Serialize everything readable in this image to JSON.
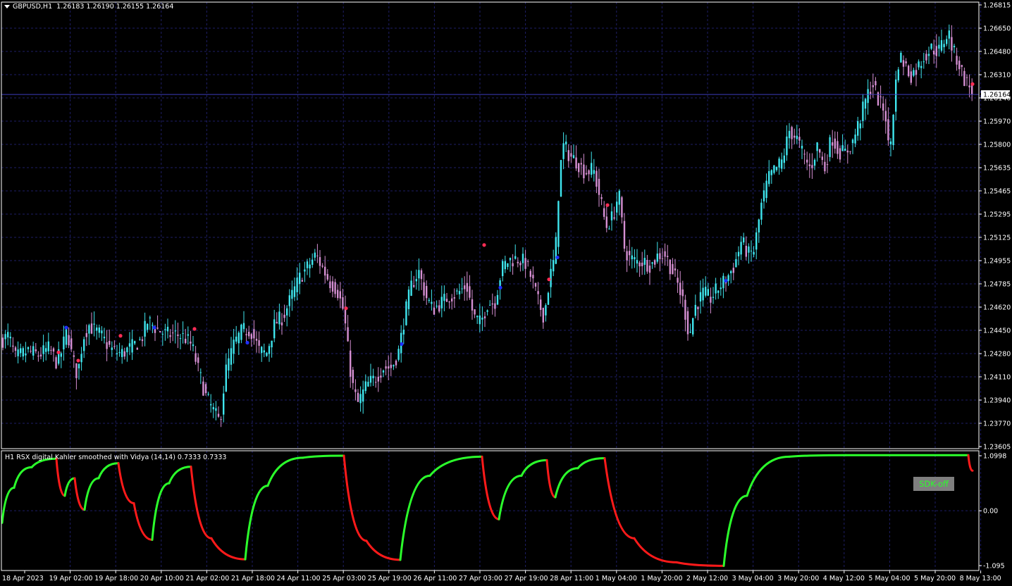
{
  "header": {
    "symbol": "GBPUSD,H1",
    "ohlc": "1.26183 1.26190 1.26155 1.26164"
  },
  "indicator": {
    "title": "H1 RSX digital Kahler smoothed with Vidya (14,14) 0.7333 0.7333",
    "button_label": "SDK-off",
    "yticks": [
      "1.0998",
      "0.00",
      "-1.095"
    ]
  },
  "colors": {
    "background": "#000000",
    "grid": "#1e1e66",
    "frame": "#ffffff",
    "candle_up": "#3fe6ee",
    "candle_down": "#d58fd2",
    "dot_up": "#1e2fff",
    "dot_down": "#ff2d55",
    "rsx_up": "#2bff2b",
    "rsx_down": "#ff1a1a",
    "button_bg": "#7f7f7f",
    "button_text": "#2bff2b"
  },
  "chart_data": {
    "type": "candlestick",
    "price_axis": {
      "ylim": [
        1.23605,
        1.26815
      ],
      "ticks": [
        "1.26815",
        "1.26650",
        "1.26480",
        "1.26310",
        "1.26140",
        "1.25970",
        "1.25800",
        "1.25635",
        "1.25465",
        "1.25295",
        "1.25125",
        "1.24955",
        "1.24785",
        "1.24620",
        "1.24450",
        "1.24280",
        "1.24110",
        "1.23940",
        "1.23770",
        "1.23605"
      ],
      "current_price": "1.26164"
    },
    "time_axis": {
      "labels": [
        "18 Apr 2023",
        "19 Apr 02:00",
        "19 Apr 18:00",
        "20 Apr 10:00",
        "21 Apr 02:00",
        "21 Apr 18:00",
        "24 Apr 11:00",
        "25 Apr 03:00",
        "25 Apr 19:00",
        "26 Apr 11:00",
        "27 Apr 03:00",
        "27 Apr 19:00",
        "28 Apr 11:00",
        "1 May 04:00",
        "1 May 20:00",
        "2 May 12:00",
        "3 May 04:00",
        "3 May 20:00",
        "4 May 12:00",
        "5 May 04:00",
        "5 May 20:00",
        "8 May 13:00"
      ]
    },
    "price_path": [
      [
        0,
        1.2437
      ],
      [
        12,
        1.2441
      ],
      [
        22,
        1.2425
      ],
      [
        40,
        1.243
      ],
      [
        55,
        1.2427
      ],
      [
        70,
        1.2432
      ],
      [
        80,
        1.2422
      ],
      [
        88,
        1.243
      ],
      [
        95,
        1.2447
      ],
      [
        102,
        1.2426
      ],
      [
        110,
        1.2412
      ],
      [
        118,
        1.244
      ],
      [
        126,
        1.2449
      ],
      [
        134,
        1.2445
      ],
      [
        142,
        1.2442
      ],
      [
        150,
        1.2436
      ],
      [
        160,
        1.243
      ],
      [
        172,
        1.2428
      ],
      [
        185,
        1.2432
      ],
      [
        200,
        1.2438
      ],
      [
        210,
        1.2452
      ],
      [
        222,
        1.2446
      ],
      [
        236,
        1.2442
      ],
      [
        250,
        1.2442
      ],
      [
        262,
        1.244
      ],
      [
        272,
        1.2434
      ],
      [
        282,
        1.2415
      ],
      [
        292,
        1.2397
      ],
      [
        304,
        1.2385
      ],
      [
        312,
        1.2378
      ],
      [
        320,
        1.2415
      ],
      [
        332,
        1.2435
      ],
      [
        344,
        1.2445
      ],
      [
        356,
        1.2445
      ],
      [
        368,
        1.243
      ],
      [
        378,
        1.2428
      ],
      [
        390,
        1.245
      ],
      [
        402,
        1.2455
      ],
      [
        414,
        1.247
      ],
      [
        426,
        1.2484
      ],
      [
        438,
        1.2492
      ],
      [
        448,
        1.25
      ],
      [
        458,
        1.249
      ],
      [
        468,
        1.248
      ],
      [
        478,
        1.2475
      ],
      [
        488,
        1.2458
      ],
      [
        496,
        1.242
      ],
      [
        502,
        1.24
      ],
      [
        508,
        1.2392
      ],
      [
        520,
        1.2405
      ],
      [
        532,
        1.241
      ],
      [
        544,
        1.2418
      ],
      [
        556,
        1.2418
      ],
      [
        566,
        1.243
      ],
      [
        574,
        1.2455
      ],
      [
        584,
        1.2478
      ],
      [
        594,
        1.2488
      ],
      [
        604,
        1.247
      ],
      [
        614,
        1.246
      ],
      [
        626,
        1.2465
      ],
      [
        638,
        1.247
      ],
      [
        650,
        1.2472
      ],
      [
        662,
        1.2478
      ],
      [
        672,
        1.2455
      ],
      [
        682,
        1.245
      ],
      [
        692,
        1.2465
      ],
      [
        702,
        1.2465
      ],
      [
        712,
        1.249
      ],
      [
        722,
        1.2496
      ],
      [
        734,
        1.2497
      ],
      [
        746,
        1.2494
      ],
      [
        756,
        1.248
      ],
      [
        764,
        1.2465
      ],
      [
        772,
        1.2455
      ],
      [
        780,
        1.2483
      ],
      [
        788,
        1.25
      ],
      [
        794,
        1.256
      ],
      [
        800,
        1.258
      ],
      [
        808,
        1.2572
      ],
      [
        818,
        1.2568
      ],
      [
        830,
        1.256
      ],
      [
        842,
        1.2562
      ],
      [
        852,
        1.254
      ],
      [
        860,
        1.252
      ],
      [
        870,
        1.2528
      ],
      [
        878,
        1.2545
      ],
      [
        886,
        1.2505
      ],
      [
        892,
        1.2498
      ],
      [
        902,
        1.2495
      ],
      [
        914,
        1.2495
      ],
      [
        924,
        1.2492
      ],
      [
        934,
        1.25
      ],
      [
        944,
        1.25
      ],
      [
        954,
        1.2488
      ],
      [
        962,
        1.2478
      ],
      [
        970,
        1.2465
      ],
      [
        978,
        1.244
      ],
      [
        986,
        1.2462
      ],
      [
        998,
        1.2472
      ],
      [
        1008,
        1.2468
      ],
      [
        1018,
        1.2475
      ],
      [
        1030,
        1.2482
      ],
      [
        1042,
        1.2492
      ],
      [
        1052,
        1.251
      ],
      [
        1062,
        1.25
      ],
      [
        1070,
        1.2503
      ],
      [
        1080,
        1.2535
      ],
      [
        1090,
        1.2555
      ],
      [
        1100,
        1.2562
      ],
      [
        1110,
        1.2568
      ],
      [
        1120,
        1.259
      ],
      [
        1130,
        1.2585
      ],
      [
        1140,
        1.2572
      ],
      [
        1150,
        1.2562
      ],
      [
        1160,
        1.258
      ],
      [
        1170,
        1.2562
      ],
      [
        1180,
        1.2586
      ],
      [
        1190,
        1.2575
      ],
      [
        1200,
        1.2574
      ],
      [
        1210,
        1.2582
      ],
      [
        1220,
        1.2598
      ],
      [
        1230,
        1.2615
      ],
      [
        1238,
        1.2625
      ],
      [
        1248,
        1.261
      ],
      [
        1256,
        1.2605
      ],
      [
        1262,
        1.257
      ],
      [
        1270,
        1.262
      ],
      [
        1276,
        1.2645
      ],
      [
        1284,
        1.2638
      ],
      [
        1292,
        1.263
      ],
      [
        1302,
        1.2636
      ],
      [
        1312,
        1.2645
      ],
      [
        1322,
        1.265
      ],
      [
        1332,
        1.2648
      ],
      [
        1340,
        1.2656
      ],
      [
        1346,
        1.2662
      ],
      [
        1352,
        1.2648
      ],
      [
        1360,
        1.264
      ],
      [
        1368,
        1.2628
      ],
      [
        1376,
        1.2622
      ],
      [
        1382,
        1.26164
      ]
    ],
    "signal_dots": [
      {
        "x": 83,
        "price": 1.2429,
        "kind": "down"
      },
      {
        "x": 94,
        "price": 1.2447,
        "kind": "up"
      },
      {
        "x": 111,
        "price": 1.2423,
        "kind": "down"
      },
      {
        "x": 171,
        "price": 1.2441,
        "kind": "down"
      },
      {
        "x": 219,
        "price": 1.2447,
        "kind": "up"
      },
      {
        "x": 276,
        "price": 1.2446,
        "kind": "down"
      },
      {
        "x": 351,
        "price": 1.2436,
        "kind": "up"
      },
      {
        "x": 491,
        "price": 1.2461,
        "kind": "down"
      },
      {
        "x": 570,
        "price": 1.2435,
        "kind": "up"
      },
      {
        "x": 687,
        "price": 1.2507,
        "kind": "down"
      },
      {
        "x": 710,
        "price": 1.2476,
        "kind": "up"
      },
      {
        "x": 779,
        "price": 1.2482,
        "kind": "down"
      },
      {
        "x": 791,
        "price": 1.2498,
        "kind": "up"
      },
      {
        "x": 862,
        "price": 1.2536,
        "kind": "down"
      },
      {
        "x": 1030,
        "price": 1.2481,
        "kind": "up"
      },
      {
        "x": 1380,
        "price": 1.2624,
        "kind": "down"
      }
    ],
    "rsx_series": [
      {
        "x": 3,
        "y": -0.24,
        "dir": "up"
      },
      {
        "x": 20,
        "y": 0.46,
        "dir": "up"
      },
      {
        "x": 45,
        "y": 0.87,
        "dir": "up"
      },
      {
        "x": 80,
        "y": 1.04,
        "dir": "up"
      },
      {
        "x": 92,
        "y": 0.3,
        "dir": "down"
      },
      {
        "x": 106,
        "y": 0.65,
        "dir": "up"
      },
      {
        "x": 120,
        "y": 0.02,
        "dir": "down"
      },
      {
        "x": 140,
        "y": 0.65,
        "dir": "up"
      },
      {
        "x": 168,
        "y": 0.95,
        "dir": "up"
      },
      {
        "x": 190,
        "y": 0.15,
        "dir": "down"
      },
      {
        "x": 216,
        "y": -0.58,
        "dir": "down"
      },
      {
        "x": 240,
        "y": 0.55,
        "dir": "up"
      },
      {
        "x": 271,
        "y": 0.88,
        "dir": "up"
      },
      {
        "x": 300,
        "y": -0.55,
        "dir": "down"
      },
      {
        "x": 348,
        "y": -0.97,
        "dir": "down"
      },
      {
        "x": 380,
        "y": 0.5,
        "dir": "up"
      },
      {
        "x": 430,
        "y": 1.06,
        "dir": "up"
      },
      {
        "x": 488,
        "y": 1.1,
        "dir": "up"
      },
      {
        "x": 520,
        "y": -0.6,
        "dir": "down"
      },
      {
        "x": 568,
        "y": -0.98,
        "dir": "down"
      },
      {
        "x": 610,
        "y": 0.7,
        "dir": "up"
      },
      {
        "x": 684,
        "y": 1.08,
        "dir": "up"
      },
      {
        "x": 708,
        "y": -0.17,
        "dir": "down"
      },
      {
        "x": 740,
        "y": 0.7,
        "dir": "up"
      },
      {
        "x": 776,
        "y": 1.01,
        "dir": "up"
      },
      {
        "x": 788,
        "y": 0.27,
        "dir": "down"
      },
      {
        "x": 820,
        "y": 0.85,
        "dir": "up"
      },
      {
        "x": 858,
        "y": 1.05,
        "dir": "up"
      },
      {
        "x": 900,
        "y": -0.55,
        "dir": "down"
      },
      {
        "x": 960,
        "y": -1.03,
        "dir": "down"
      },
      {
        "x": 1027,
        "y": -1.1,
        "dir": "down"
      },
      {
        "x": 1060,
        "y": 0.3,
        "dir": "up"
      },
      {
        "x": 1120,
        "y": 1.08,
        "dir": "up"
      },
      {
        "x": 1200,
        "y": 1.11,
        "dir": "up"
      },
      {
        "x": 1374,
        "y": 1.11,
        "dir": "up"
      },
      {
        "x": 1380,
        "y": 0.8,
        "dir": "down"
      }
    ],
    "rsx_ylim": [
      -1.095,
      1.0998
    ]
  }
}
